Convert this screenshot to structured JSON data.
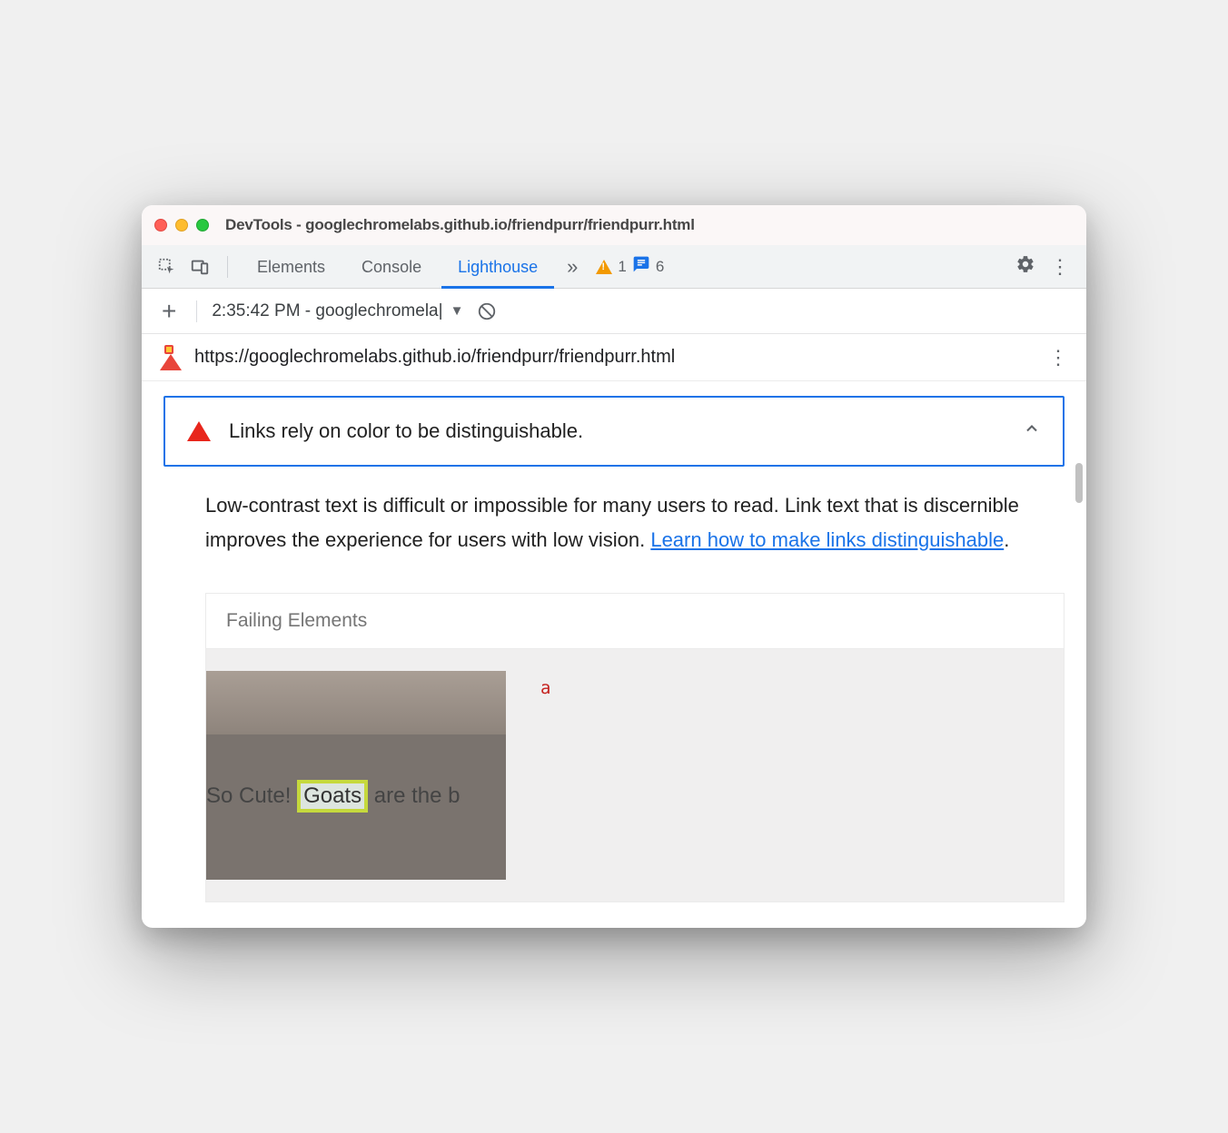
{
  "window": {
    "title": "DevTools - googlechromelabs.github.io/friendpurr/friendpurr.html"
  },
  "tabs": {
    "elements": "Elements",
    "console": "Console",
    "lighthouse": "Lighthouse"
  },
  "badges": {
    "warnings": "1",
    "messages": "6"
  },
  "subtoolbar": {
    "run_label": "2:35:42 PM - googlechromela"
  },
  "urlbar": {
    "url": "https://googlechromelabs.github.io/friendpurr/friendpurr.html"
  },
  "audit": {
    "title": "Links rely on color to be distinguishable.",
    "description_a": "Low-contrast text is difficult or impossible for many users to read. Link text that is discernible improves the experience for users with low vision. ",
    "learn_link": "Learn how to make links distinguishable",
    "desc_period": "."
  },
  "failing": {
    "header": "Failing Elements",
    "thumb_prefix": "So Cute! ",
    "thumb_highlight": "Goats",
    "thumb_suffix": " are the b",
    "element_tag": "a"
  }
}
